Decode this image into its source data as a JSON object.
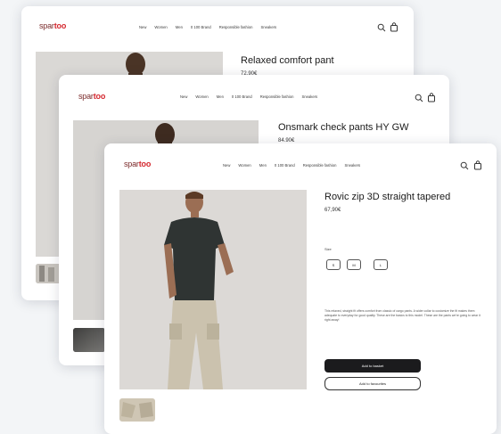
{
  "brand": {
    "logo_part1": "spar",
    "logo_part2": "too"
  },
  "nav": {
    "items": [
      "New",
      "Women",
      "Men",
      "0 100 Brand",
      "Responsible fashion",
      "Sneakers"
    ]
  },
  "icons": {
    "search": "search-icon",
    "bag": "shopping-bag-icon"
  },
  "cards": [
    {
      "title": "Relaxed comfort pant",
      "price": "72.90€"
    },
    {
      "title": "Onsmark check pants HY GW",
      "price": "84.90€"
    },
    {
      "title": "Rovic zip 3D straight tapered",
      "price": "67,90€",
      "size_label": "Size",
      "sizes": [
        "S",
        "M",
        "L"
      ],
      "description": "This relaxed, straight fit offers comfort from classic of cargo pants. A wider collar to customize the fit makes them adequate to everyday for good quality. These are the basics to this model. These are the pants we're going to wear it right away!",
      "add_to_basket": "Add to basket",
      "add_to_favourites": "Add to favourites"
    }
  ],
  "colors": {
    "accent": "#d4282f",
    "button_dark": "#1b1b1d",
    "background": "#f3f5f7"
  }
}
